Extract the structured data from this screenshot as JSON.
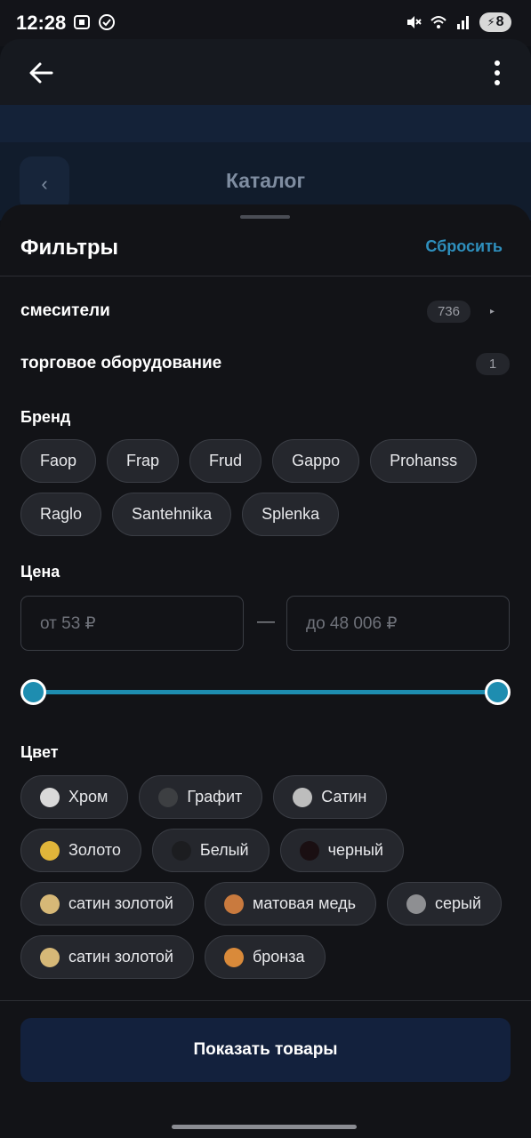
{
  "status_bar": {
    "time": "12:28",
    "battery_level": "8"
  },
  "app_bar": {
    "back_icon": "arrow-left-icon",
    "more_icon": "more-vertical-icon"
  },
  "background_page": {
    "title": "Каталог",
    "back_glyph": "‹"
  },
  "filters": {
    "title": "Фильтры",
    "reset_label": "Сбросить",
    "categories": [
      {
        "label": "смесители",
        "count": "736",
        "has_arrow": true
      },
      {
        "label": "торговое оборудование",
        "count": "1",
        "has_arrow": false
      }
    ],
    "brand": {
      "title": "Бренд",
      "options": [
        "Faop",
        "Frap",
        "Frud",
        "Gappo",
        "Prohanss",
        "Raglo",
        "Santehnika",
        "Splenka"
      ]
    },
    "price": {
      "title": "Цена",
      "from_placeholder": "от 53 ₽",
      "to_placeholder": "до 48 006 ₽",
      "dash": "—",
      "slider_min_fraction": 0,
      "slider_max_fraction": 1,
      "accent": "#1e8db0"
    },
    "color": {
      "title": "Цвет",
      "options": [
        {
          "label": "Хром",
          "swatch": "#d9d9d9"
        },
        {
          "label": "Графит",
          "swatch": "#3d3f42"
        },
        {
          "label": "Сатин",
          "swatch": "#bdbdbd"
        },
        {
          "label": "Золото",
          "swatch": "#e0b53a"
        },
        {
          "label": "Белый",
          "swatch": "#1c1d20"
        },
        {
          "label": "черный",
          "swatch": "#1a0f12"
        },
        {
          "label": "сатин золотой",
          "swatch": "#d6b877"
        },
        {
          "label": "матовая медь",
          "swatch": "#c97a3e"
        },
        {
          "label": "серый",
          "swatch": "#8e8f92"
        },
        {
          "label": "сатин золотой",
          "swatch": "#d6b877"
        },
        {
          "label": "бронза",
          "swatch": "#d98a3a"
        }
      ]
    },
    "submit_label": "Показать товары"
  }
}
